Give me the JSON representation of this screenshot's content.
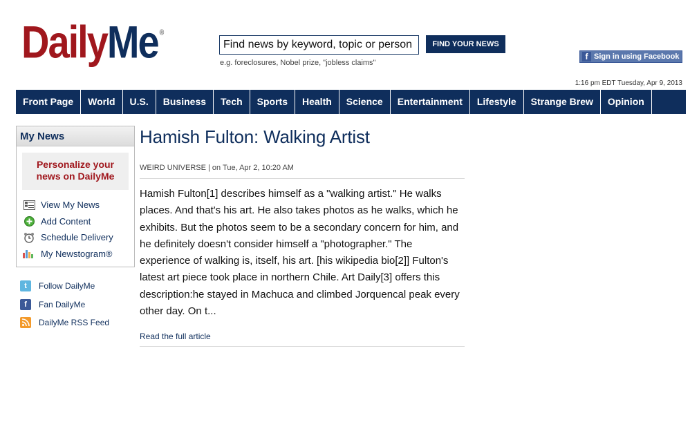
{
  "header": {
    "logo_daily": "Daily",
    "logo_me": "Me",
    "logo_reg": "®",
    "search_value": "Find news by keyword, topic or person",
    "search_button": "FIND YOUR NEWS",
    "search_hint": "e.g. foreclosures, Nobel prize, \"jobless claims\"",
    "facebook_button": "Sign in using Facebook",
    "datestamp": "1:16 pm EDT Tuesday, Apr 9, 2013"
  },
  "nav": {
    "items": [
      {
        "label": "Front Page"
      },
      {
        "label": "World"
      },
      {
        "label": "U.S."
      },
      {
        "label": "Business"
      },
      {
        "label": "Tech"
      },
      {
        "label": "Sports"
      },
      {
        "label": "Health"
      },
      {
        "label": "Science"
      },
      {
        "label": "Entertainment"
      },
      {
        "label": "Lifestyle"
      },
      {
        "label": "Strange Brew"
      },
      {
        "label": "Opinion"
      }
    ]
  },
  "sidebar": {
    "mynews_title": "My News",
    "personalize_line1": "Personalize your",
    "personalize_line2": "news on DailyMe",
    "items": [
      {
        "label": "View My News",
        "icon": "list-icon"
      },
      {
        "label": "Add Content",
        "icon": "add-icon"
      },
      {
        "label": "Schedule Delivery",
        "icon": "clock-icon"
      },
      {
        "label": "My Newstogram®",
        "icon": "bar-chart-icon"
      }
    ],
    "social": [
      {
        "label": "Follow DailyMe",
        "icon": "twitter-icon"
      },
      {
        "label": "Fan DailyMe",
        "icon": "facebook-icon"
      },
      {
        "label": "DailyMe RSS Feed",
        "icon": "rss-icon"
      }
    ]
  },
  "article": {
    "title": "Hamish Fulton: Walking Artist",
    "byline": "WEIRD UNIVERSE | on Tue, Apr 2, 10:20 AM",
    "body": "Hamish Fulton[1] describes himself as a \"walking artist.\" He walks places. And that's his art. He also takes photos as he walks, which he exhibits. But the photos seem to be a secondary concern for him, and he definitely doesn't consider himself a \"photographer.\" The experience of walking is, itself, his art. [his wikipedia bio[2]] Fulton's latest art piece took place in northern Chile. Art Daily[3] offers this description:he stayed in Machuca and climbed Jorquencal peak every other day. On t...",
    "read_more": "Read the full article"
  },
  "colors": {
    "brand_red": "#a0171d",
    "brand_navy": "#0f2e5c",
    "facebook_blue": "#3b5998"
  }
}
